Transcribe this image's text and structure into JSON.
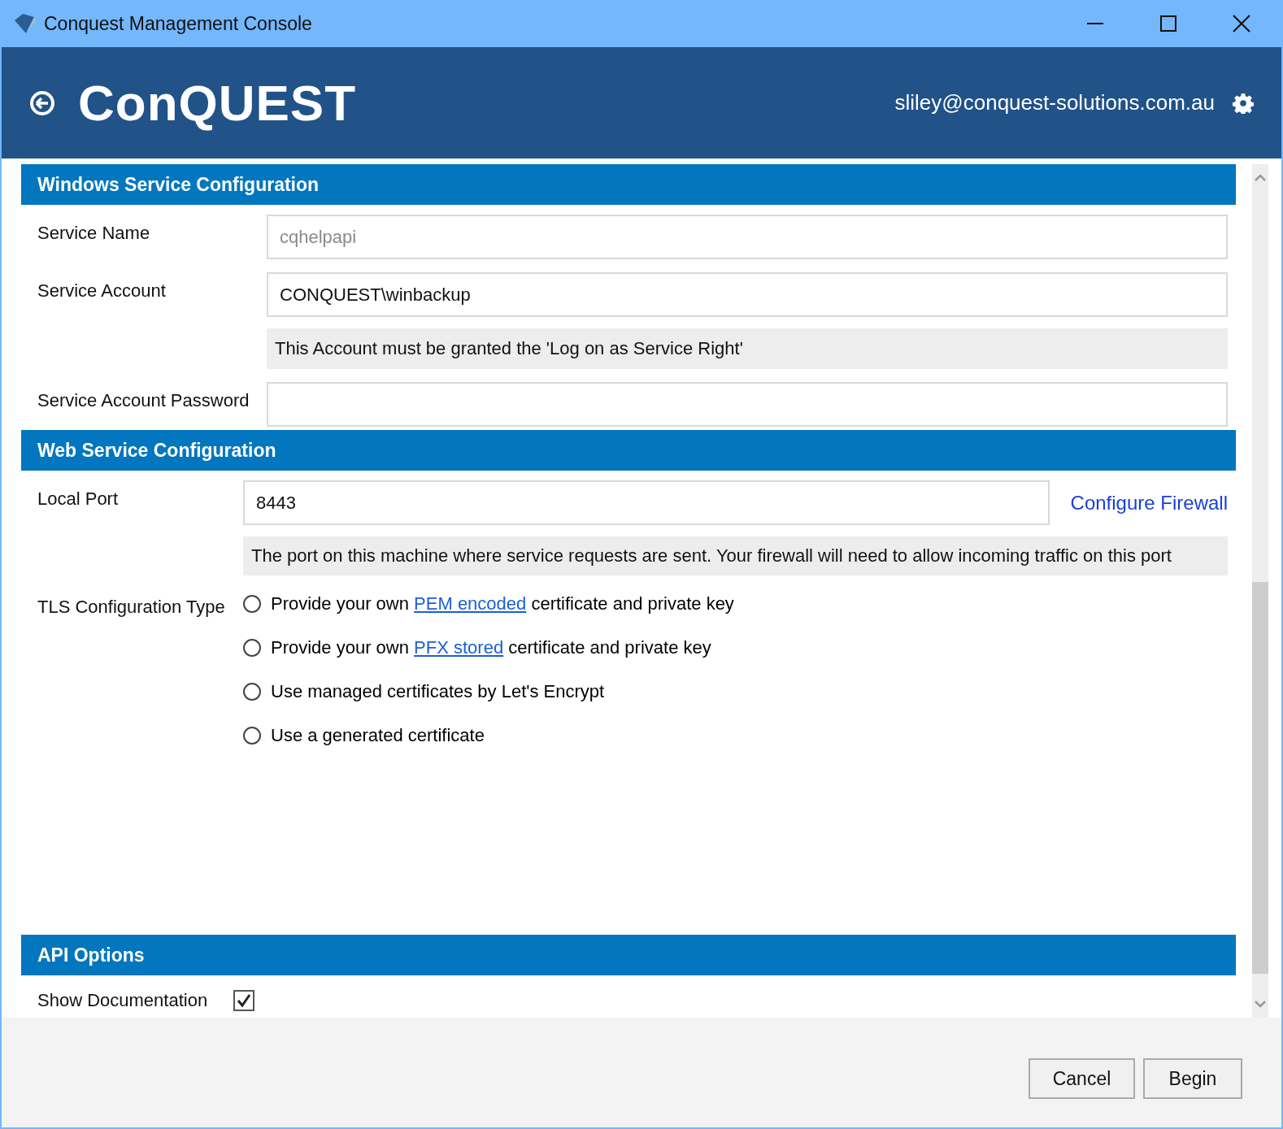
{
  "window": {
    "title": "Conquest Management Console"
  },
  "header": {
    "logo": "ConQUEST",
    "user": "sliley@conquest-solutions.com.au"
  },
  "sections": [
    {
      "title": "Windows Service Configuration",
      "rows": [
        {
          "kind": "field",
          "label": "Service Name",
          "placeholder": "cqhelpapi"
        },
        {
          "kind": "field",
          "label": "Service Account",
          "value": "CONQUEST\\winbackup",
          "note": "This Account must be granted the 'Log on as Service Right'"
        },
        {
          "kind": "field",
          "label": "Service Account Password"
        }
      ]
    },
    {
      "title": "Web Service Configuration",
      "rows": [
        {
          "kind": "port",
          "label": "Local Port",
          "value": "8443",
          "link": "Configure Firewall",
          "note": "The port on this machine where service requests are sent. Your firewall will need to allow incoming traffic on this port"
        },
        {
          "kind": "radios",
          "label": "TLS Configuration Type",
          "options": [
            {
              "before": "Provide your own ",
              "link": "PEM encoded",
              "after": " certificate and private key",
              "selected": false
            },
            {
              "before": "Provide your own ",
              "link": "PFX stored",
              "after": " certificate and private key",
              "selected": false
            },
            {
              "before": "Use managed certificates by Let's Encrypt",
              "selected": false
            },
            {
              "before": "Use a generated certificate",
              "selected": false
            }
          ]
        }
      ]
    },
    {
      "title": "API Options",
      "rows": [
        {
          "kind": "check",
          "label": "Show Documentation",
          "checked": true
        }
      ]
    }
  ],
  "buttons": [
    "Cancel",
    "Begin"
  ]
}
